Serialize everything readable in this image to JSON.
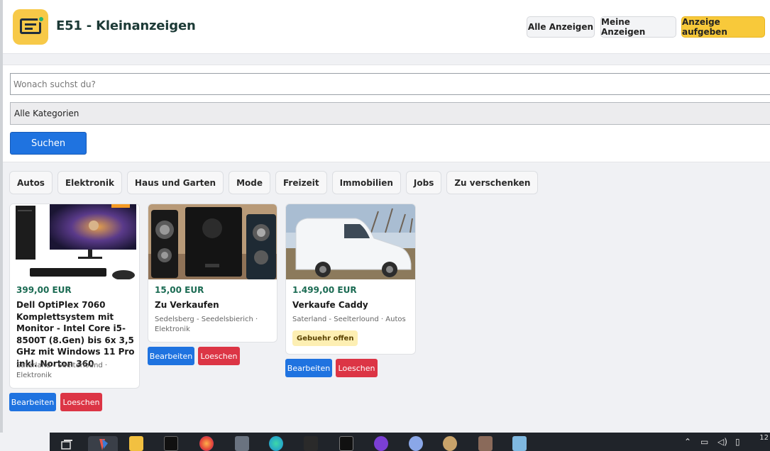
{
  "header": {
    "app_title": "E51 - Kleinanzeigen",
    "buttons": [
      "Alle Anzeigen",
      "Meine Anzeigen",
      "Anzeige aufgeben"
    ]
  },
  "search": {
    "placeholder": "Wonach suchst du?",
    "category_selected": "Alle Kategorien",
    "submit_label": "Suchen"
  },
  "categories": [
    "Autos",
    "Elektronik",
    "Haus und Garten",
    "Mode",
    "Freizeit",
    "Immobilien",
    "Jobs",
    "Zu verschenken"
  ],
  "listings": [
    {
      "price": "399,00 EUR",
      "title": "Dell OptiPlex 7060 Komplettsystem mit Monitor - Intel Core i5-8500T (8.Gen) bis 6x 3,5 GHz mit Windows 11 Pro inkl. Norton 360",
      "meta": "Saterland - Seelterlound · Elektronik",
      "edit_label": "Bearbeiten",
      "delete_label": "Loeschen"
    },
    {
      "price": "15,00 EUR",
      "title": "Zu Verkaufen",
      "meta": "Sedelsberg - Seedelsbierich · Elektronik",
      "edit_label": "Bearbeiten",
      "delete_label": "Loeschen"
    },
    {
      "price": "1.499,00 EUR",
      "title": "Verkaufe Caddy",
      "meta": "Saterland - Seelterlound · Autos",
      "badge": "Gebuehr offen",
      "edit_label": "Bearbeiten",
      "delete_label": "Loeschen"
    }
  ],
  "taskbar": {
    "clock": "12"
  }
}
